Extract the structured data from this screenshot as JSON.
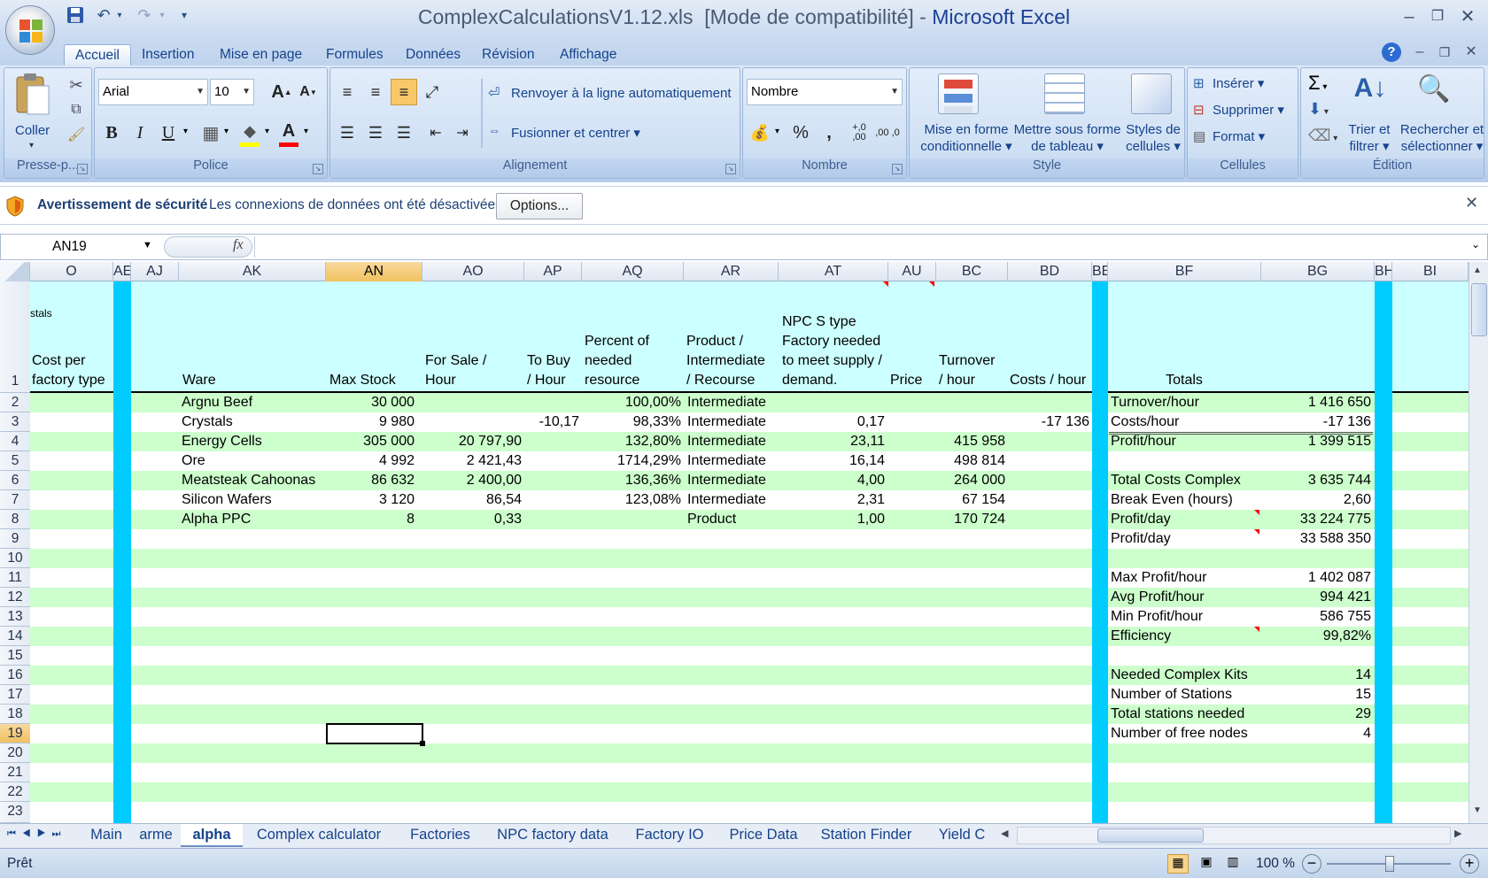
{
  "window": {
    "title_file": "ComplexCalculationsV1.12.xls",
    "title_mode": "[Mode de compatibilité]",
    "title_sep": "-",
    "title_app": "Microsoft Excel"
  },
  "ribbon_tabs": [
    "Accueil",
    "Insertion",
    "Mise en page",
    "Formules",
    "Données",
    "Révision",
    "Affichage"
  ],
  "ribbon": {
    "clipboard": {
      "paste": "Coller",
      "label": "Presse-p..."
    },
    "font": {
      "name": "Arial",
      "size": "10",
      "label": "Police",
      "bold": "B",
      "italic": "I",
      "underline": "U"
    },
    "alignment": {
      "wrap": "Renvoyer à la ligne automatiquement",
      "merge": "Fusionner et centrer",
      "label": "Alignement"
    },
    "number": {
      "format": "Nombre",
      "label": "Nombre",
      "percent": "%",
      "thousands": ",",
      "inc_dec": "+,0 ,00",
      "dec_dec": ",00 ,0"
    },
    "style": {
      "conditional": "Mise en forme conditionnelle",
      "table": "Mettre sous forme de tableau",
      "cell_styles": "Styles de cellules",
      "label": "Style"
    },
    "cells": {
      "insert": "Insérer",
      "delete": "Supprimer",
      "format": "Format",
      "label": "Cellules"
    },
    "editing": {
      "sort": "Trier et filtrer",
      "find": "Rechercher et sélectionner",
      "label": "Édition",
      "sigma": "Σ"
    }
  },
  "security": {
    "title": "Avertissement de sécurité",
    "message": "Les connexions de données ont été désactivées",
    "button": "Options..."
  },
  "formula_bar": {
    "name_box": "AN19",
    "fx": "fx",
    "content": ""
  },
  "columns": [
    "O",
    "AE",
    "AJ",
    "AK",
    "AN",
    "AO",
    "AP",
    "AQ",
    "AR",
    "AT",
    "AU",
    "BC",
    "BD",
    "BE",
    "BF",
    "BG",
    "BH",
    "BI"
  ],
  "rows": [
    "1",
    "2",
    "3",
    "4",
    "5",
    "6",
    "7",
    "8",
    "9",
    "10",
    "11",
    "12",
    "13",
    "14",
    "15",
    "16",
    "17",
    "18",
    "19",
    "20",
    "21",
    "22",
    "23"
  ],
  "header_cells": {
    "o_top": "stals",
    "o_line1": "Cost per",
    "o_line2": "factory type",
    "ak": "Ware",
    "an": "Max Stock",
    "ao_1": "For Sale /",
    "ao_2": "Hour",
    "ap_1": "To Buy",
    "ap_2": "/ Hour",
    "aq_1": "Percent of",
    "aq_2": "needed",
    "aq_3": "resource",
    "ar_1": "Product /",
    "ar_2": "Intermediate",
    "ar_3": "/ Recourse",
    "at_1": "NPC S type",
    "at_2": "Factory needed",
    "at_3": "to meet supply /",
    "at_4": "demand.",
    "au": "Price",
    "bc_1": "Turnover",
    "bc_2": "/ hour",
    "bd": "Costs / hour",
    "bf": "Totals"
  },
  "wares": [
    {
      "ware": "Argnu Beef",
      "max_stock": "30 000",
      "for_sale": "",
      "to_buy": "",
      "percent": "100,00%",
      "type": "Intermediate",
      "npc": "",
      "turnover": "",
      "costs": ""
    },
    {
      "ware": "Crystals",
      "max_stock": "9 980",
      "for_sale": "",
      "to_buy": "-10,17",
      "percent": "98,33%",
      "type": "Intermediate",
      "npc": "0,17",
      "turnover": "",
      "costs": "-17 136"
    },
    {
      "ware": "Energy Cells",
      "max_stock": "305 000",
      "for_sale": "20 797,90",
      "to_buy": "",
      "percent": "132,80%",
      "type": "Intermediate",
      "npc": "23,11",
      "turnover": "415 958",
      "costs": ""
    },
    {
      "ware": "Ore",
      "max_stock": "4 992",
      "for_sale": "2 421,43",
      "to_buy": "",
      "percent": "1714,29%",
      "type": "Intermediate",
      "npc": "16,14",
      "turnover": "498 814",
      "costs": ""
    },
    {
      "ware": "Meatsteak Cahoonas",
      "max_stock": "86 632",
      "for_sale": "2 400,00",
      "to_buy": "",
      "percent": "136,36%",
      "type": "Intermediate",
      "npc": "4,00",
      "turnover": "264 000",
      "costs": ""
    },
    {
      "ware": "Silicon Wafers",
      "max_stock": "3 120",
      "for_sale": "86,54",
      "to_buy": "",
      "percent": "123,08%",
      "type": "Intermediate",
      "npc": "2,31",
      "turnover": "67 154",
      "costs": ""
    },
    {
      "ware": "Alpha PPC",
      "max_stock": "8",
      "for_sale": "0,33",
      "to_buy": "",
      "percent": "",
      "type": "Product",
      "npc": "1,00",
      "turnover": "170 724",
      "costs": ""
    }
  ],
  "totals": [
    {
      "label": "Turnover/hour",
      "value": "1 416 650"
    },
    {
      "label": "Costs/hour",
      "value": "-17 136"
    },
    {
      "label": "Profit/hour",
      "value": "1 399 515"
    },
    {
      "label": "",
      "value": ""
    },
    {
      "label": "Total Costs Complex",
      "value": "3 635 744"
    },
    {
      "label": "Break Even (hours)",
      "value": "2,60"
    },
    {
      "label": "Profit/day",
      "value": "33 224 775"
    },
    {
      "label": "Profit/day",
      "value": "33 588 350"
    },
    {
      "label": "",
      "value": ""
    },
    {
      "label": "Max Profit/hour",
      "value": "1 402 087"
    },
    {
      "label": "Avg Profit/hour",
      "value": "994 421"
    },
    {
      "label": "Min Profit/hour",
      "value": "586 755"
    },
    {
      "label": "Efficiency",
      "value": "99,82%"
    },
    {
      "label": "",
      "value": ""
    },
    {
      "label": "Needed Complex Kits",
      "value": "14"
    },
    {
      "label": "Number of Stations",
      "value": "15"
    },
    {
      "label": "Total stations needed",
      "value": "29"
    },
    {
      "label": "Number of free nodes",
      "value": "4"
    }
  ],
  "sheet_tabs": [
    "Main",
    "arme",
    "alpha",
    "Complex calculator",
    "Factories",
    "NPC factory data",
    "Factory IO",
    "Price Data",
    "Station Finder",
    "Yield C"
  ],
  "active_sheet": "alpha",
  "status": {
    "text": "Prêt",
    "zoom": "100 %"
  },
  "colors": {
    "row_fill": "#ccffcc",
    "stripe": "#00ccff",
    "sheet_bg": "#ccffff",
    "title_app": "#1c3f94"
  }
}
